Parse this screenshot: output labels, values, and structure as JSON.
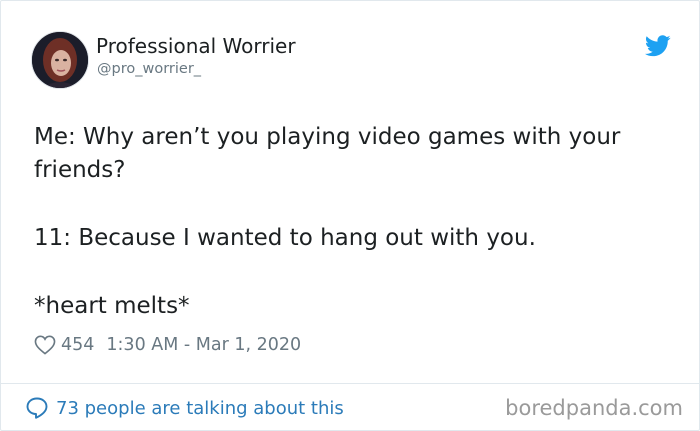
{
  "tweet": {
    "author_name": "Professional Worrier",
    "handle": "@pro_worrier_",
    "lines": [
      "Me: Why aren’t you playing video games with your friends?",
      "11: Because I wanted to hang out with you.",
      "*heart melts*"
    ],
    "likes": "454",
    "timestamp": "1:30 AM - Mar 1, 2020",
    "conversation_label": "73 people are talking about this"
  },
  "watermark": "boredpanda.com",
  "icons": {
    "like": "heart-icon",
    "platform": "twitter-bird-icon",
    "conversation": "speech-bubble-icon"
  },
  "colors": {
    "text": "#1c2022",
    "muted": "#697882",
    "link": "#2b7bb9",
    "twitter_blue": "#1da1f2",
    "watermark": "#9a9a9a"
  }
}
